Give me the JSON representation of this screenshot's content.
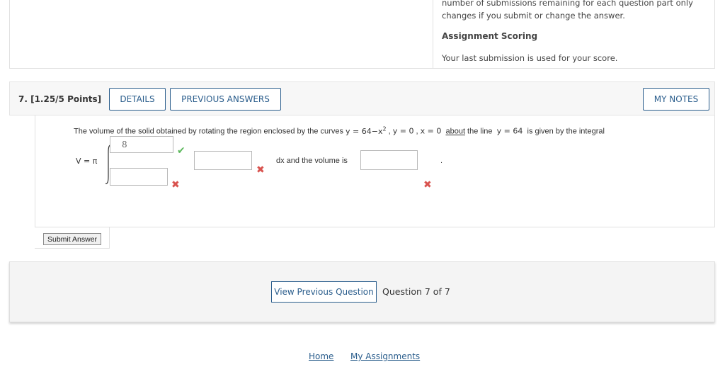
{
  "top_info": {
    "line1": "number of submissions remaining for each question part only",
    "line2": "changes if you submit or change the answer.",
    "scoring_heading": "Assignment Scoring",
    "scoring_text": "Your last submission is used for your score."
  },
  "question": {
    "title": "7.  [1.25/5 Points]",
    "details_label": "DETAILS",
    "previous_answers_label": "PREVIOUS ANSWERS",
    "my_notes_label": "MY NOTES",
    "sentence_prefix": "The volume of the solid obtained by rotating the region enclosed by the curves ",
    "curve1": "y = 64−x",
    "curve1_exp": "2",
    "sep1": " , ",
    "curve2": "y = 0",
    "sep2": " , ",
    "curve3": "x = 0",
    "about_word": "about",
    "sentence_mid": " the line ",
    "line_eq": "y = 64",
    "sentence_suffix": " is given by the integral",
    "v_label": "V = π",
    "upper_limit_value": "8",
    "dx_text": "dx  and the volume is",
    "period": ".",
    "correct_mark": "✔",
    "wrong_mark": "✖",
    "submit_label": "Submit Answer"
  },
  "navigation": {
    "prev_question_label": "View Previous Question",
    "question_count": "Question 7 of 7"
  },
  "footer": {
    "home": "Home",
    "my_assignments": "My Assignments"
  },
  "colors": {
    "link_blue": "#2a5d8c",
    "correct_green": "#5cb85c",
    "wrong_red": "#d9534f"
  }
}
